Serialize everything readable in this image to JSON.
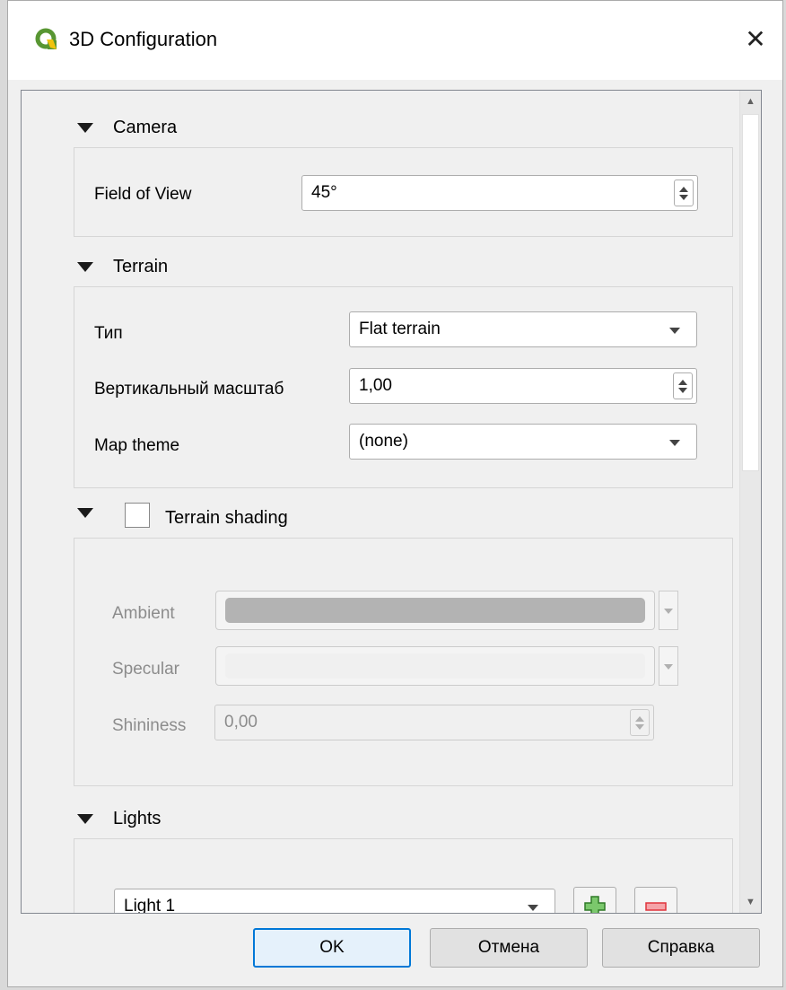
{
  "window": {
    "title": "3D Configuration",
    "close_glyph": "✕"
  },
  "camera": {
    "header": "Camera",
    "field_of_view": {
      "label": "Field of View",
      "value": "45°"
    }
  },
  "terrain": {
    "header": "Terrain",
    "type": {
      "label": "Тип",
      "value": "Flat terrain"
    },
    "vertical_scale": {
      "label": "Вертикальный масштаб",
      "value": "1,00"
    },
    "map_theme": {
      "label": "Map theme",
      "value": "(none)"
    }
  },
  "terrain_shading": {
    "header": "Terrain shading",
    "checked": false,
    "ambient": {
      "label": "Ambient",
      "color": "#b3b3b3"
    },
    "specular": {
      "label": "Specular",
      "color": "#f0f0f0"
    },
    "shininess": {
      "label": "Shininess",
      "value": "0,00"
    }
  },
  "lights": {
    "header": "Lights",
    "selected_light": "Light 1",
    "add_icon": "plus-icon",
    "remove_icon": "minus-icon"
  },
  "buttons": {
    "ok": "OK",
    "cancel": "Отмена",
    "help": "Справка"
  },
  "colors": {
    "accent": "#0078d7",
    "qgis_green": "#589632",
    "qgis_yellow": "#f0c30e",
    "remove_red": "#e0343c"
  }
}
